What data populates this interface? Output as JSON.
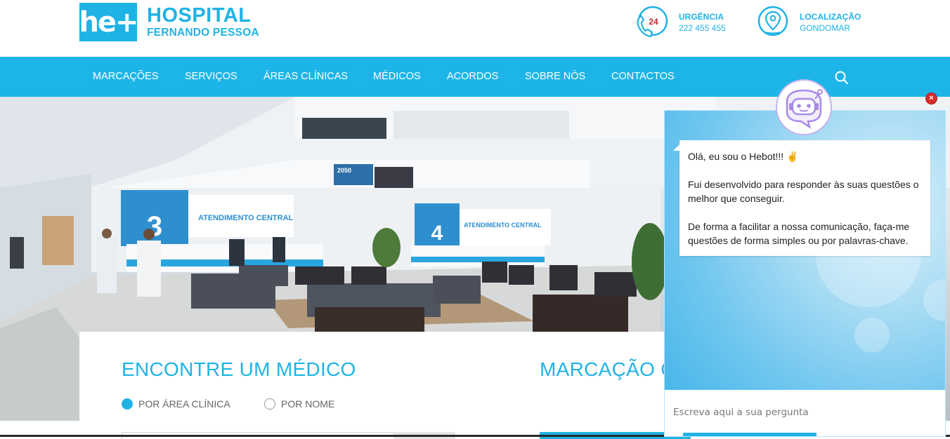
{
  "brand": {
    "logo_mark": "he+",
    "name_line1": "HOSPITAL",
    "name_line2": "FERNANDO PESSOA",
    "accent_color": "#1fb3e5"
  },
  "header": {
    "urgency": {
      "title": "URGÊNCIA",
      "value": "222 455 455",
      "badge": "24",
      "icon": "phone-24-icon"
    },
    "location": {
      "title": "LOCALIZAÇÃO",
      "value": "GONDOMAR",
      "icon": "map-pin-icon"
    }
  },
  "nav": {
    "items": [
      {
        "label": "MARCAÇÕES"
      },
      {
        "label": "SERVIÇOS"
      },
      {
        "label": "ÁREAS CLÍNICAS"
      },
      {
        "label": "MÉDICOS"
      },
      {
        "label": "ACORDOS"
      },
      {
        "label": "SOBRE NÓS"
      },
      {
        "label": "CONTACTOS"
      }
    ],
    "search_icon": "search-icon"
  },
  "hero": {
    "signs": [
      {
        "number": "3",
        "text": "ATENDIMENTO CENTRAL"
      },
      {
        "number": "4",
        "text": "ATENDIMENTO CENTRAL"
      }
    ],
    "screen_text": "2050"
  },
  "finder": {
    "title": "ENCONTRE UM MÉDICO",
    "title_right": "MARCAÇÃO C",
    "options": [
      {
        "label": "POR ÁREA CLÍNICA",
        "selected": true
      },
      {
        "label": "POR NOME",
        "selected": false
      }
    ]
  },
  "chat": {
    "messages": [
      "Olá, eu sou o Hebot!!! ✌",
      "Fui desenvolvido para responder às suas questões o melhor que conseguir.",
      "De forma a facilitar a nossa comunicação, faça-me questões de forma simples ou por palavras-chave."
    ],
    "input_placeholder": "Escreva aqui a sua pergunta",
    "close_label": "×",
    "avatar_icon": "robot-chat-icon"
  }
}
